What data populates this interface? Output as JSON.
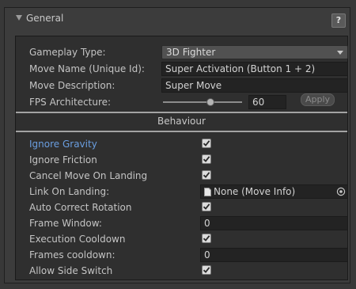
{
  "header": {
    "title": "General",
    "help_label": "?"
  },
  "general": {
    "gameplay_type": {
      "label": "Gameplay Type:",
      "value": "3D Fighter"
    },
    "move_name": {
      "label": "Move Name (Unique Id):",
      "value": "Super Activation (Button 1 + 2)"
    },
    "move_description": {
      "label": "Move Description:",
      "value": "Super Move"
    },
    "fps": {
      "label": "FPS Architecture:",
      "value": "60",
      "slider_fraction": 0.6,
      "apply_label": "Apply"
    }
  },
  "behaviour": {
    "title": "Behaviour",
    "ignore_gravity": {
      "label": "Ignore Gravity",
      "checked": true
    },
    "ignore_friction": {
      "label": "Ignore Friction",
      "checked": true
    },
    "cancel_move_on_landing": {
      "label": "Cancel Move On Landing",
      "checked": true
    },
    "link_on_landing": {
      "label": "Link On Landing:",
      "value": "None (Move Info)"
    },
    "auto_correct_rotation": {
      "label": "Auto Correct Rotation",
      "checked": true
    },
    "frame_window": {
      "label": "Frame Window:",
      "value": "0"
    },
    "execution_cooldown": {
      "label": "Execution Cooldown",
      "checked": true
    },
    "frames_cooldown": {
      "label": "Frames cooldown:",
      "value": "0"
    },
    "allow_side_switch": {
      "label": "Allow Side Switch",
      "checked": true
    }
  },
  "icons": {
    "foldout": "triangle-down-icon",
    "help": "question-icon",
    "dropdown": "chevron-down-icon",
    "check": "checkmark-icon",
    "object": "document-icon",
    "picker": "target-icon"
  },
  "colors": {
    "highlight_label": "#6a9ee0",
    "panel_bg": "#3c3c3c",
    "inner_bg": "#2f2f2f"
  }
}
